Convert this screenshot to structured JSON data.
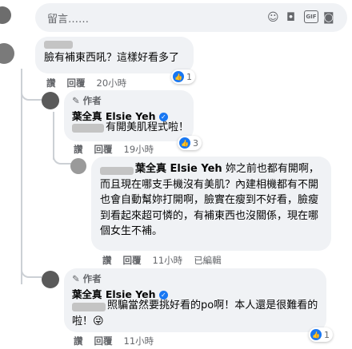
{
  "composer": {
    "placeholder": "留言……",
    "icons": [
      "emoji-icon",
      "camera-icon",
      "gif-icon",
      "sticker-icon"
    ],
    "gif_label": "GIF"
  },
  "comments": [
    {
      "text": "臉有補東西吼？這樣好看多了",
      "actions": [
        "讚",
        "回覆"
      ],
      "time": "20小時",
      "reaction_count": "1"
    },
    {
      "author_tag": "作者",
      "name": "葉全真 Elsie Yeh",
      "text": "有開美肌程式啦！",
      "actions": [
        "讚",
        "回覆"
      ],
      "time": "19小時",
      "reaction_count": "3"
    },
    {
      "mention": "葉全真 Elsie Yeh",
      "text": " 妳之前也都有開啊，而且現在哪支手機沒有美肌？內建相機都有不開也會自動幫妳打開啊，臉實在瘦到不好看，臉瘦到看起來超可憐的，有補東西也沒關係，現在哪個女生不補。",
      "actions": [
        "讚",
        "回覆"
      ],
      "time": "11小時",
      "edited": "已編輯"
    },
    {
      "author_tag": "作者",
      "name": "葉全真 Elsie Yeh",
      "text": "照騙當然要挑好看的po啊！本人還是很難看的啦！",
      "emoji": "😜",
      "actions": [
        "讚",
        "回覆"
      ],
      "time": "11小時",
      "reaction_count": "1"
    }
  ],
  "colors": {
    "bubble": "#f0f2f5",
    "like_blue": "#1877f2",
    "secondary_text": "#65676b"
  }
}
